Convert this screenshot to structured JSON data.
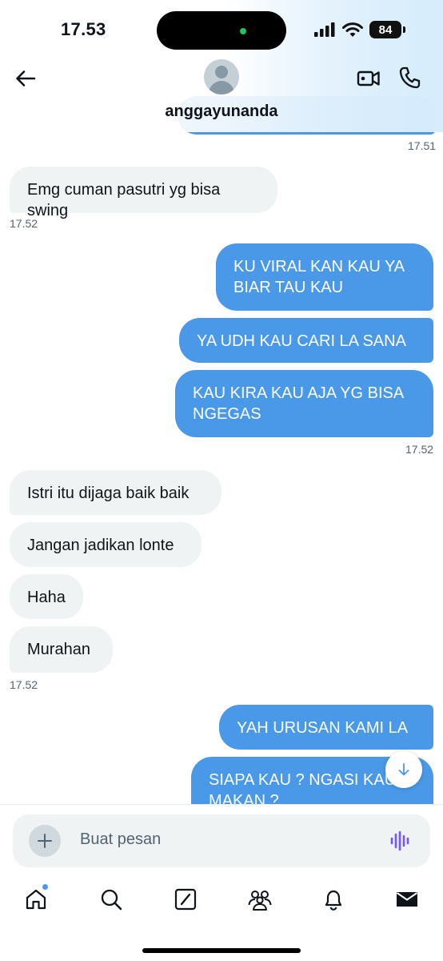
{
  "status_bar": {
    "time": "17.53",
    "battery": "84"
  },
  "conversation": {
    "username": "anggayunanda"
  },
  "messages": [
    {
      "dir": "out",
      "text": ""
    },
    {
      "dir": "time",
      "text": "17.51"
    },
    {
      "dir": "in",
      "text": "Emg cuman pasutri yg bisa swing"
    },
    {
      "dir": "time",
      "text": "17.52"
    },
    {
      "dir": "out",
      "text": "KU VIRAL KAN KAU YA BIAR TAU KAU"
    },
    {
      "dir": "out",
      "text": "YA UDH KAU CARI LA SANA"
    },
    {
      "dir": "out",
      "text": "KAU KIRA KAU AJA YG BISA NGEGAS"
    },
    {
      "dir": "time",
      "text": "17.52"
    },
    {
      "dir": "in",
      "text": "Istri itu dijaga baik baik"
    },
    {
      "dir": "in",
      "text": "Jangan jadikan lonte"
    },
    {
      "dir": "in",
      "text": "Haha"
    },
    {
      "dir": "in",
      "text": "Murahan"
    },
    {
      "dir": "time",
      "text": "17.52"
    },
    {
      "dir": "out",
      "text": "YAH URUSAN KAMI LA"
    },
    {
      "dir": "out",
      "text": "SIAPA KAU ? NGASI KAU MAKAN ?"
    }
  ],
  "composer": {
    "placeholder": "Buat pesan"
  },
  "tabs": [
    "home-icon",
    "search-icon",
    "grok-icon",
    "communities-icon",
    "notifications-icon",
    "messages-icon"
  ],
  "colors": {
    "accent": "#4a99e9",
    "incoming_bubble": "#eff3f4",
    "voice": "#7856ff"
  }
}
